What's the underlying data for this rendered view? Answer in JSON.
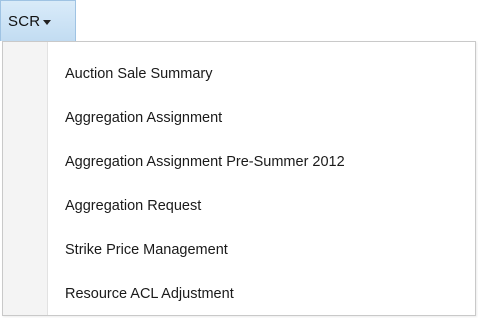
{
  "menu": {
    "button_label": "SCR",
    "caret_icon": "caret-down-icon",
    "items": [
      {
        "label": "Auction Sale Summary"
      },
      {
        "label": "Aggregation Assignment"
      },
      {
        "label": "Aggregation Assignment Pre-Summer 2012"
      },
      {
        "label": "Aggregation Request"
      },
      {
        "label": "Strike Price Management"
      },
      {
        "label": "Resource ACL Adjustment"
      }
    ]
  },
  "colors": {
    "button_background": "#c9e1f6",
    "button_border": "#9fc3e3",
    "dropdown_border": "#c9c9c9",
    "gutter": "#f4f4f4"
  }
}
